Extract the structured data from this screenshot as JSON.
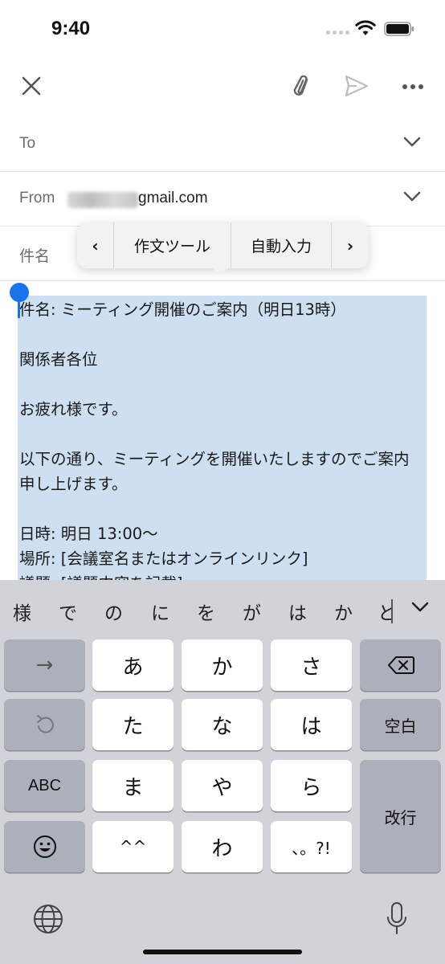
{
  "status_bar": {
    "time": "9:40"
  },
  "compose": {
    "to_label": "To",
    "from_label": "From",
    "from_domain": "gmail.com",
    "subject_placeholder": "件名"
  },
  "context_menu": {
    "prev": "‹",
    "items": [
      "作文ツール",
      "自動入力"
    ],
    "next": "›"
  },
  "body_text": "件名: ミーティング開催のご案内（明日13時）\n\n関係者各位\n\nお疲れ様です。\n\n以下の通り、ミーティングを開催いたしますのでご案内申し上げます。\n\n日時: 明日 13:00〜\n場所: [会議室名またはオンラインリンク]\n議題: [議題内容を記載]",
  "keyboard": {
    "candidates": [
      "様",
      "で",
      "の",
      "に",
      "を",
      "が",
      "は",
      "か",
      "と"
    ],
    "keys": {
      "arrow": "→",
      "a": "あ",
      "ka": "か",
      "sa": "さ",
      "ta": "た",
      "na": "な",
      "ha": "は",
      "abc": "ABC",
      "ma": "ま",
      "ya": "や",
      "ra": "ら",
      "emoticon": "^^",
      "wa": "わ",
      "punct": "、。?!",
      "space": "空白",
      "enter": "改行"
    }
  }
}
